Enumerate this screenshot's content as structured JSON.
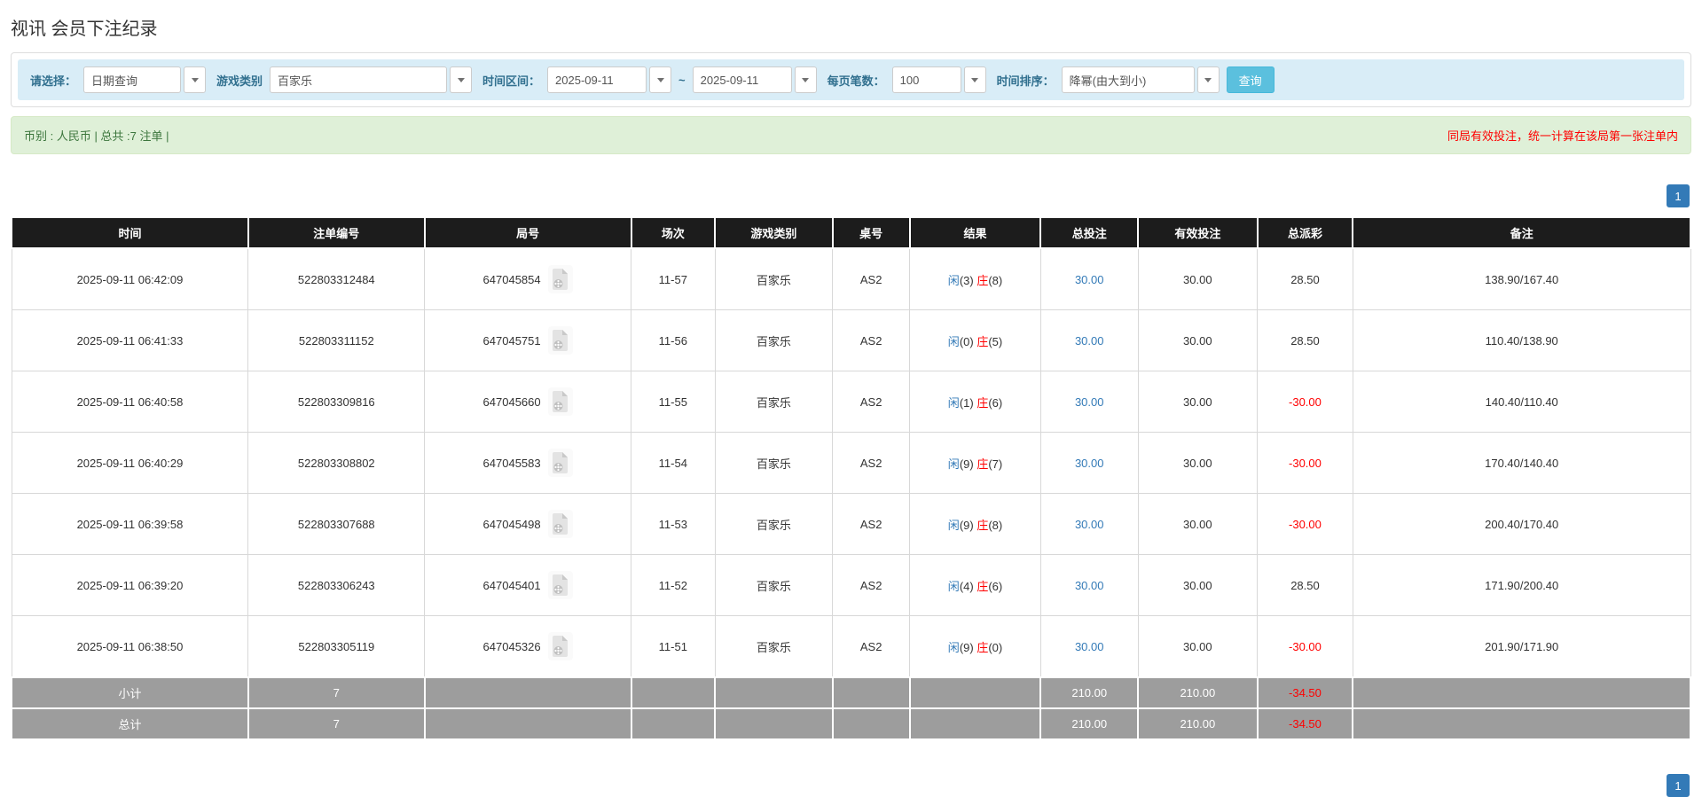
{
  "page": {
    "title": "视讯 会员下注纪录"
  },
  "filters": {
    "mode": {
      "label": "请选择：",
      "value": "日期查询"
    },
    "game_type": {
      "label": "游戏类别",
      "value": "百家乐"
    },
    "date_range": {
      "label": "时间区间：",
      "from": "2025-09-11",
      "separator": "~",
      "to": "2025-09-11"
    },
    "page_size": {
      "label": "每页笔数：",
      "value": "100"
    },
    "sort": {
      "label": "时间排序：",
      "value": "降幂(由大到小)"
    },
    "search_button": "查询"
  },
  "summary": {
    "currency_info": "币别 : 人民币 | 总共 :7 注单 |",
    "note": "同局有效投注，统一计算在该局第一张注单内"
  },
  "pagination": {
    "page": "1"
  },
  "icons": {
    "dropdown": "caret-down-icon",
    "round_media": "film-document-icon"
  },
  "colors": {
    "filter_bar_bg": "#d9edf7",
    "filter_label": "#31708f",
    "search_button_bg": "#5bc0de",
    "summary_bg": "#dff0d8",
    "summary_text": "#3c763d",
    "alert_red": "#ff0000",
    "table_header_bg": "#1c1c1c",
    "subtotal_bg": "#9d9d9d",
    "link_blue": "#337ab7",
    "player_blue": "#337ab7",
    "banker_red": "#ff0000",
    "pager_active_bg": "#337ab7"
  },
  "table": {
    "headers": {
      "time": "时间",
      "bet_id": "注单编号",
      "round_id": "局号",
      "session": "场次",
      "game_type": "游戏类别",
      "table_no": "桌号",
      "result": "结果",
      "total_bet": "总投注",
      "valid_bet": "有效投注",
      "payout": "总派彩",
      "remark": "备注"
    },
    "rows": [
      {
        "time": "2025-09-11 06:42:09",
        "bet_id": "522803312484",
        "round_id": "647045854",
        "session": "11-57",
        "game_type": "百家乐",
        "table_no": "AS2",
        "player": "闲",
        "player_n": "(3)",
        "banker": "庄",
        "banker_n": "(8)",
        "total_bet": "30.00",
        "valid_bet": "30.00",
        "payout": "28.50",
        "remark": "138.90/167.40"
      },
      {
        "time": "2025-09-11 06:41:33",
        "bet_id": "522803311152",
        "round_id": "647045751",
        "session": "11-56",
        "game_type": "百家乐",
        "table_no": "AS2",
        "player": "闲",
        "player_n": "(0)",
        "banker": "庄",
        "banker_n": "(5)",
        "total_bet": "30.00",
        "valid_bet": "30.00",
        "payout": "28.50",
        "remark": "110.40/138.90"
      },
      {
        "time": "2025-09-11 06:40:58",
        "bet_id": "522803309816",
        "round_id": "647045660",
        "session": "11-55",
        "game_type": "百家乐",
        "table_no": "AS2",
        "player": "闲",
        "player_n": "(1)",
        "banker": "庄",
        "banker_n": "(6)",
        "total_bet": "30.00",
        "valid_bet": "30.00",
        "payout": "-30.00",
        "remark": "140.40/110.40"
      },
      {
        "time": "2025-09-11 06:40:29",
        "bet_id": "522803308802",
        "round_id": "647045583",
        "session": "11-54",
        "game_type": "百家乐",
        "table_no": "AS2",
        "player": "闲",
        "player_n": "(9)",
        "banker": "庄",
        "banker_n": "(7)",
        "total_bet": "30.00",
        "valid_bet": "30.00",
        "payout": "-30.00",
        "remark": "170.40/140.40"
      },
      {
        "time": "2025-09-11 06:39:58",
        "bet_id": "522803307688",
        "round_id": "647045498",
        "session": "11-53",
        "game_type": "百家乐",
        "table_no": "AS2",
        "player": "闲",
        "player_n": "(9)",
        "banker": "庄",
        "banker_n": "(8)",
        "total_bet": "30.00",
        "valid_bet": "30.00",
        "payout": "-30.00",
        "remark": "200.40/170.40"
      },
      {
        "time": "2025-09-11 06:39:20",
        "bet_id": "522803306243",
        "round_id": "647045401",
        "session": "11-52",
        "game_type": "百家乐",
        "table_no": "AS2",
        "player": "闲",
        "player_n": "(4)",
        "banker": "庄",
        "banker_n": "(6)",
        "total_bet": "30.00",
        "valid_bet": "30.00",
        "payout": "28.50",
        "remark": "171.90/200.40"
      },
      {
        "time": "2025-09-11 06:38:50",
        "bet_id": "522803305119",
        "round_id": "647045326",
        "session": "11-51",
        "game_type": "百家乐",
        "table_no": "AS2",
        "player": "闲",
        "player_n": "(9)",
        "banker": "庄",
        "banker_n": "(0)",
        "total_bet": "30.00",
        "valid_bet": "30.00",
        "payout": "-30.00",
        "remark": "201.90/171.90"
      }
    ],
    "subtotal": {
      "label": "小计",
      "count": "7",
      "total_bet": "210.00",
      "valid_bet": "210.00",
      "payout": "-34.50"
    },
    "total": {
      "label": "总计",
      "count": "7",
      "total_bet": "210.00",
      "valid_bet": "210.00",
      "payout": "-34.50"
    }
  }
}
